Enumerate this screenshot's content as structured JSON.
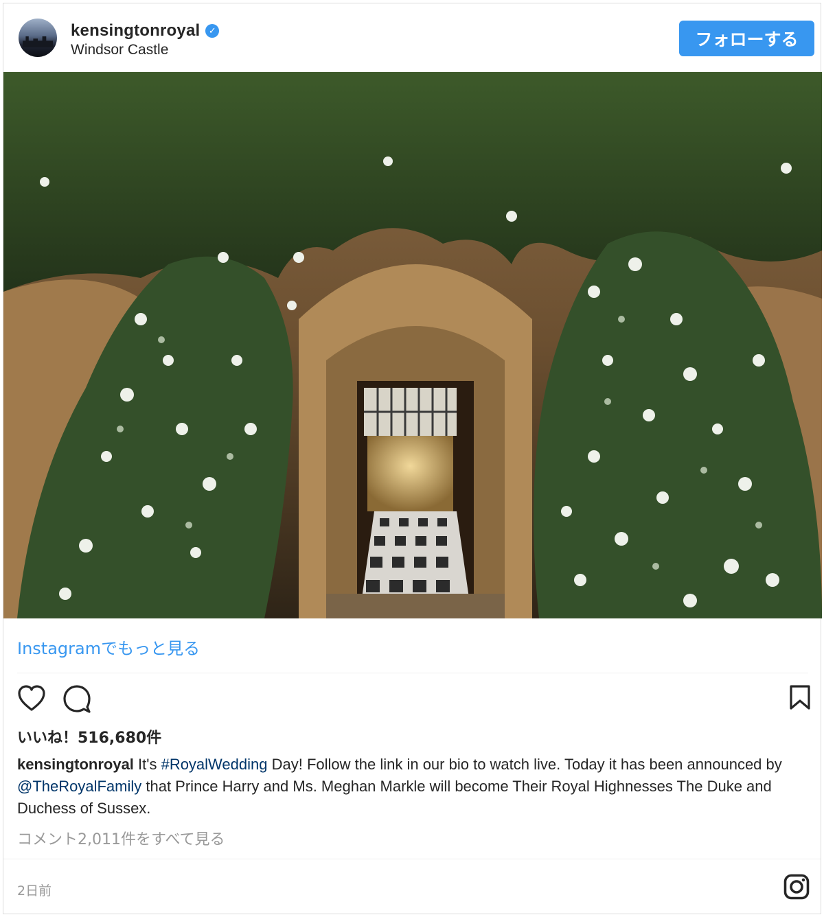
{
  "header": {
    "username": "kensingtonroyal",
    "verified_icon": "verified-badge-icon",
    "location": "Windsor Castle",
    "follow_label": "フォローする"
  },
  "post": {
    "more_on_instagram": "Instagramでもっと見る",
    "likes_text": "いいね！516,680件",
    "caption": {
      "user": "kensingtonroyal",
      "part1": " It's ",
      "hashtag": "#RoyalWedding",
      "part2": " Day! Follow the link in our bio to watch live. Today it has been announced by ",
      "mention": "@TheRoyalFamily",
      "part3": " that Prince Harry and Ms. Meghan Markle will become Their Royal Highnesses The Duke and Duchess of Sussex."
    },
    "view_comments": "コメント2,011件をすべて見る",
    "timestamp": "2日前"
  },
  "icons": [
    "heart-icon",
    "comment-icon",
    "bookmark-icon",
    "instagram-logo-icon"
  ],
  "colors": {
    "accent": "#3897f0",
    "text": "#262626",
    "muted": "#999999",
    "border": "#dbdbdb"
  }
}
